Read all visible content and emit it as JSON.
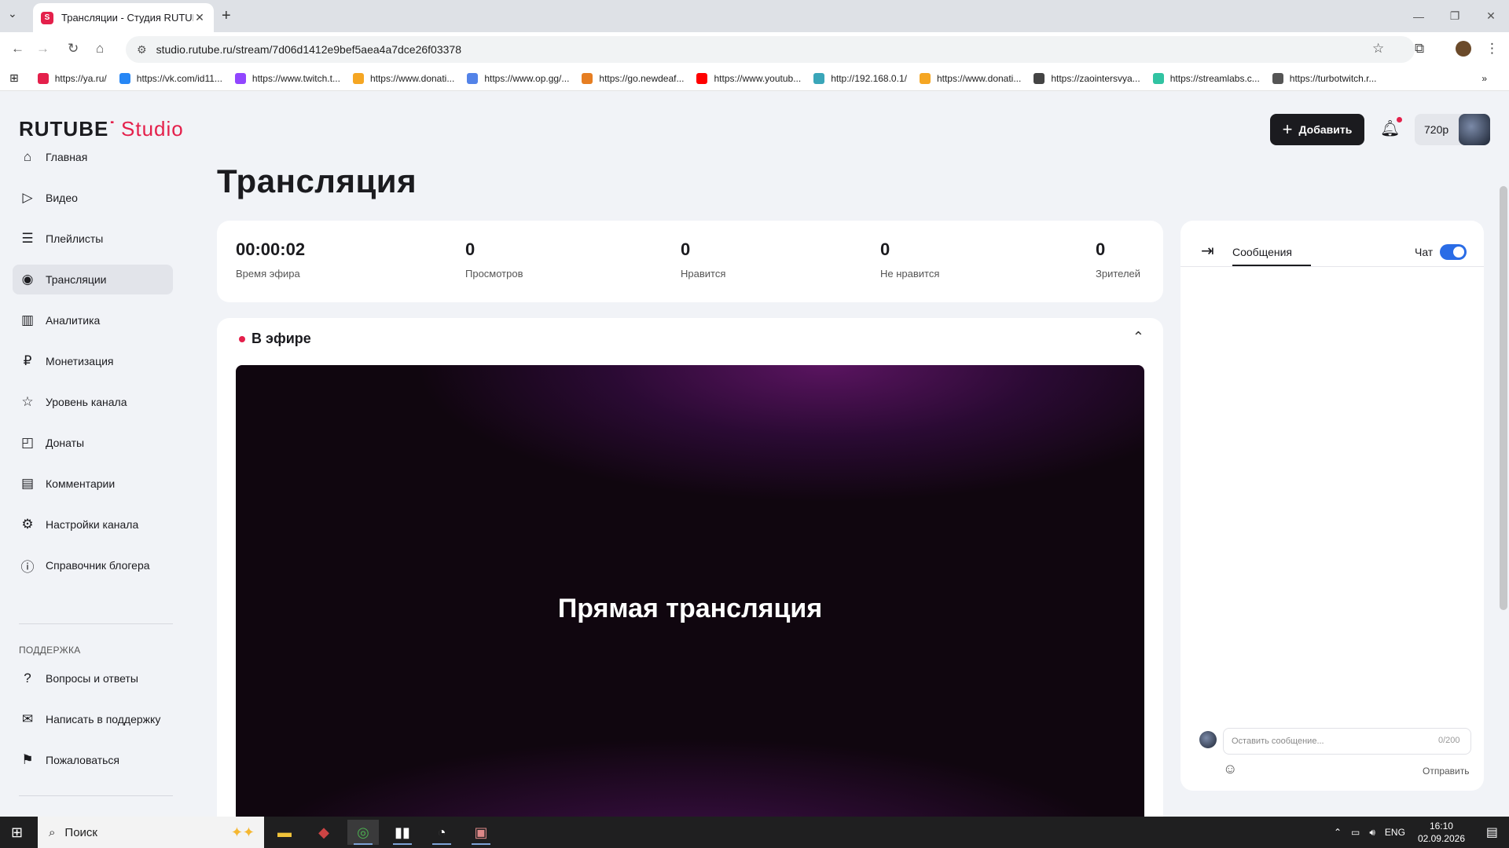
{
  "browser": {
    "tab_title": "Трансляции - Студия RUTUBE",
    "url": "studio.rutube.ru/stream/7d06d1412e9bef5aea4a7dce26f03378",
    "bookmarks": [
      {
        "label": "https://ya.ru/",
        "color": "#e4204b"
      },
      {
        "label": "https://vk.com/id11...",
        "color": "#2787f5"
      },
      {
        "label": "https://www.twitch.t...",
        "color": "#9146ff"
      },
      {
        "label": "https://www.donati...",
        "color": "#f5a623"
      },
      {
        "label": "https://www.op.gg/...",
        "color": "#5383e8"
      },
      {
        "label": "https://go.newdeaf...",
        "color": "#e67e22"
      },
      {
        "label": "https://www.youtub...",
        "color": "#ff0000"
      },
      {
        "label": "http://192.168.0.1/",
        "color": "#3aa6b9"
      },
      {
        "label": "https://www.donati...",
        "color": "#f5a623"
      },
      {
        "label": "https://zaointersvya...",
        "color": "#444444"
      },
      {
        "label": "https://streamlabs.c...",
        "color": "#31c3a2"
      },
      {
        "label": "https://turbotwitch.r...",
        "color": "#555555"
      }
    ]
  },
  "app": {
    "logo_main": "RUTUBE",
    "logo_studio": "Studio",
    "add_button": "Добавить",
    "quality": "720p",
    "page_title": "Трансляция",
    "sidebar": {
      "items": [
        {
          "label": "Главная",
          "icon": "home-icon",
          "glyph": "⌂"
        },
        {
          "label": "Видео",
          "icon": "video-icon",
          "glyph": "▷"
        },
        {
          "label": "Плейлисты",
          "icon": "playlist-icon",
          "glyph": "☰"
        },
        {
          "label": "Трансляции",
          "icon": "broadcast-icon",
          "glyph": "◉"
        },
        {
          "label": "Аналитика",
          "icon": "analytics-icon",
          "glyph": "▥"
        },
        {
          "label": "Монетизация",
          "icon": "ruble-icon",
          "glyph": "₽"
        },
        {
          "label": "Уровень канала",
          "icon": "star-icon",
          "glyph": "☆"
        },
        {
          "label": "Донаты",
          "icon": "wallet-icon",
          "glyph": "◰"
        },
        {
          "label": "Комментарии",
          "icon": "comment-icon",
          "glyph": "▤"
        },
        {
          "label": "Настройки канала",
          "icon": "gear-icon",
          "glyph": "⚙"
        },
        {
          "label": "Справочник блогера",
          "icon": "info-icon",
          "glyph": "ⓘ"
        }
      ],
      "support_title": "ПОДДЕРЖКА",
      "support_items": [
        {
          "label": "Вопросы и ответы",
          "icon": "question-icon",
          "glyph": "?"
        },
        {
          "label": "Написать в поддержку",
          "icon": "mail-icon",
          "glyph": "✉"
        },
        {
          "label": "Пожаловаться",
          "icon": "flag-icon",
          "glyph": "⚑"
        }
      ]
    },
    "stats": {
      "airtime": {
        "value": "00:00:02",
        "label": "Время эфира"
      },
      "views": {
        "value": "0",
        "label": "Просмотров"
      },
      "likes": {
        "value": "0",
        "label": "Нравится"
      },
      "dislikes": {
        "value": "0",
        "label": "Не нравится"
      },
      "viewers": {
        "value": "0",
        "label": "Зрителей"
      }
    },
    "live": {
      "header": "В эфире",
      "player_text": "Прямая трансляция"
    },
    "chat": {
      "tab": "Сообщения",
      "toggle_label": "Чат",
      "placeholder": "Оставить сообщение...",
      "counter": "0/200",
      "send": "Отправить"
    }
  },
  "taskbar": {
    "search_label": "Поиск",
    "lang": "ENG",
    "time": "16:10",
    "date": "02.09.2026"
  }
}
